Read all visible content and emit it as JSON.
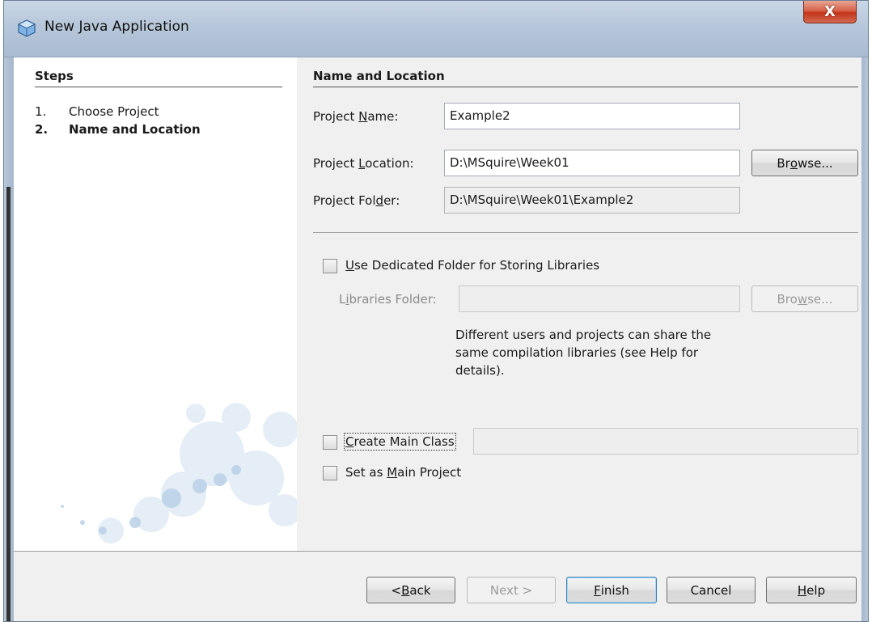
{
  "window": {
    "title": "New Java Application",
    "close_label": "X"
  },
  "steps": {
    "heading": "Steps",
    "items": [
      {
        "num": "1.",
        "label": "Choose Project",
        "active": false
      },
      {
        "num": "2.",
        "label": "Name and Location",
        "active": true
      }
    ]
  },
  "main": {
    "section_title": "Name and Location",
    "project_name": {
      "label_pre": "Project ",
      "label_mn": "N",
      "label_post": "ame:",
      "value": "Example2"
    },
    "project_location": {
      "label_pre": "Project ",
      "label_mn": "L",
      "label_post": "ocation:",
      "value": "D:\\MSquire\\Week01"
    },
    "project_folder": {
      "label_pre": "Project Fol",
      "label_mn": "d",
      "label_post": "er:",
      "value": "D:\\MSquire\\Week01\\Example2"
    },
    "browse_button": {
      "pre": "Br",
      "mn": "o",
      "post": "wse..."
    },
    "dedicated_folder": {
      "mn": "U",
      "post": "se Dedicated Folder for Storing Libraries",
      "checked": false
    },
    "libraries_folder": {
      "pre": "L",
      "mn": "i",
      "post": "braries Folder:",
      "value": ""
    },
    "browse_button_2": {
      "pre": "Bro",
      "mn": "w",
      "post": "se..."
    },
    "help_text": "Different users and projects can share the same compilation libraries (see Help for details).",
    "create_main_class": {
      "mn": "C",
      "post": "reate Main Class",
      "checked": false,
      "value": ""
    },
    "set_main_project": {
      "pre": "Set as ",
      "mn": "M",
      "post": "ain Project",
      "checked": false
    }
  },
  "footer": {
    "back": {
      "pre": "< ",
      "mn": "B",
      "post": "ack"
    },
    "next": "Next >",
    "finish": {
      "mn": "F",
      "post": "inish"
    },
    "cancel": "Cancel",
    "help": {
      "mn": "H",
      "post": "elp"
    }
  },
  "colors": {
    "titlebar": "#b7c7da",
    "close": "#c4341b",
    "panel": "#f0f0f0"
  }
}
